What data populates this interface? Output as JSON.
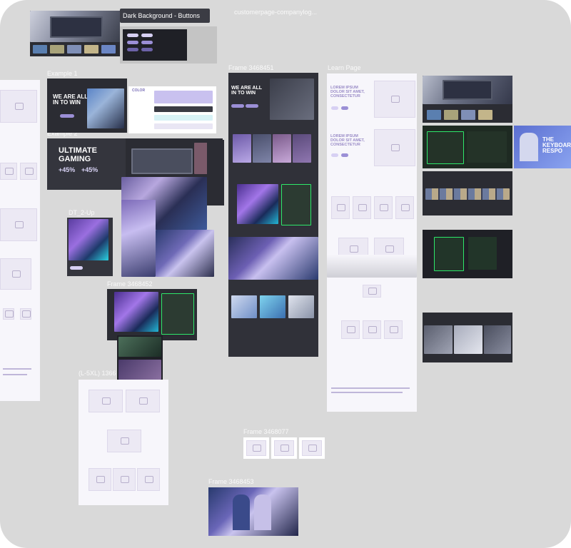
{
  "canvas": {
    "background": "#d9d9d9"
  },
  "frame_labels": {
    "dark_background_buttons": "Dark Background - Buttons",
    "customer_page": "customerpage-companylog...",
    "example_1": "Example 1",
    "example_2": "Example 2",
    "frame_3468451": "Frame 3468451",
    "learn_page": "Learn Page",
    "dt_2_up": "DT_2-Up",
    "frame_3468452": "Frame 3468452",
    "lxl_1366": "(L-5XL) 1366",
    "frame_3468077": "Frame 3468077",
    "frame_3468453": "Frame 3468453"
  },
  "thumb_text": {
    "we_are_all_in_to_win": "WE ARE ALL IN TO WIN",
    "ultimate_gaming": "ULTIMATE GAMING",
    "stat_a": "+45%",
    "stat_b": "+45%",
    "lorem_1": "LOREM IPSUM DOLOR SIT AMET, CONSECTETUR",
    "lorem_2": "LOREM IPSUM DOLOR SIT AMET, CONSECTETUR",
    "respo": "THE KEYBOARD RESPO",
    "color": "COLOR"
  },
  "colors": {
    "accent": "#9b8fd6",
    "dark": "#2b2c33",
    "neon_green": "#2ee86a",
    "lavender": "#c9c1ef"
  }
}
